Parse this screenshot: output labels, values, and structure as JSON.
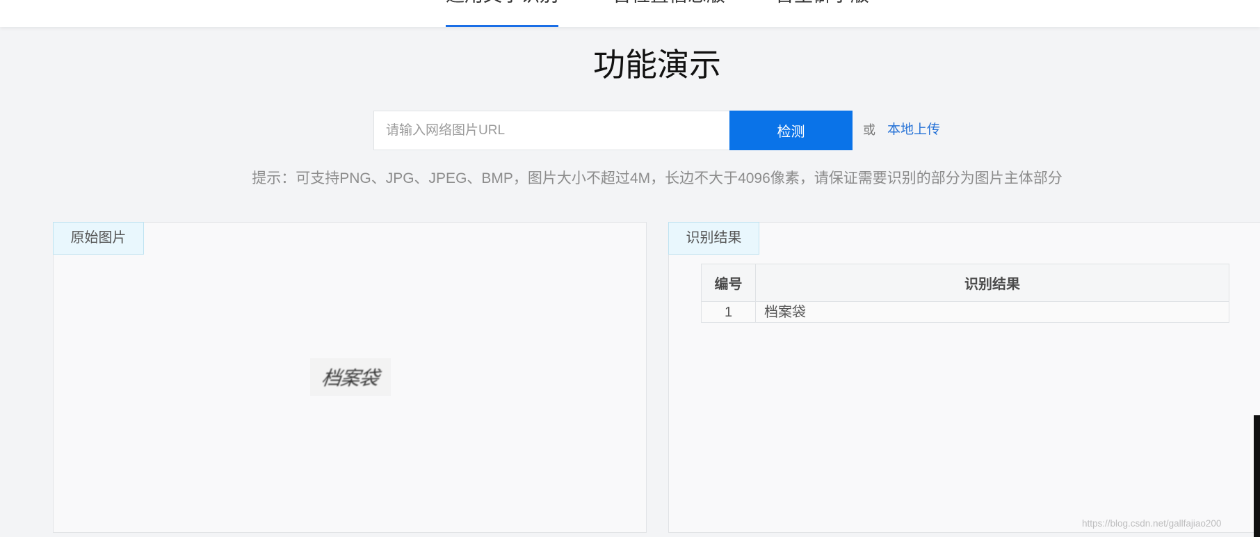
{
  "nav": {
    "tabs": [
      {
        "label": "通用文字识别",
        "active": true
      },
      {
        "label": "含位置信息版",
        "active": false
      },
      {
        "label": "含生僻字版",
        "active": false
      }
    ]
  },
  "title": "功能演示",
  "url_input": {
    "placeholder": "请输入网络图片URL",
    "value": ""
  },
  "detect_button_label": "检测",
  "or_text": "或",
  "local_upload_label": "本地上传",
  "hint": "提示：可支持PNG、JPG、JPEG、BMP，图片大小不超过4M，长边不大于4096像素，请保证需要识别的部分为图片主体部分",
  "original_panel": {
    "tab_label": "原始图片",
    "image_text": "档案袋"
  },
  "result_panel": {
    "tab_label": "识别结果",
    "table": {
      "headers": [
        "编号",
        "识别结果"
      ],
      "rows": [
        [
          "1",
          "档案袋"
        ]
      ]
    }
  },
  "watermark": "https://blog.csdn.net/gallfajiao200",
  "colors": {
    "accent": "#0a73e8",
    "link": "#2471d6",
    "active_tab_underline": "#1a6ee6",
    "page_bg": "#f3f4f6",
    "panel_tab_bg": "#e9f7fd"
  }
}
